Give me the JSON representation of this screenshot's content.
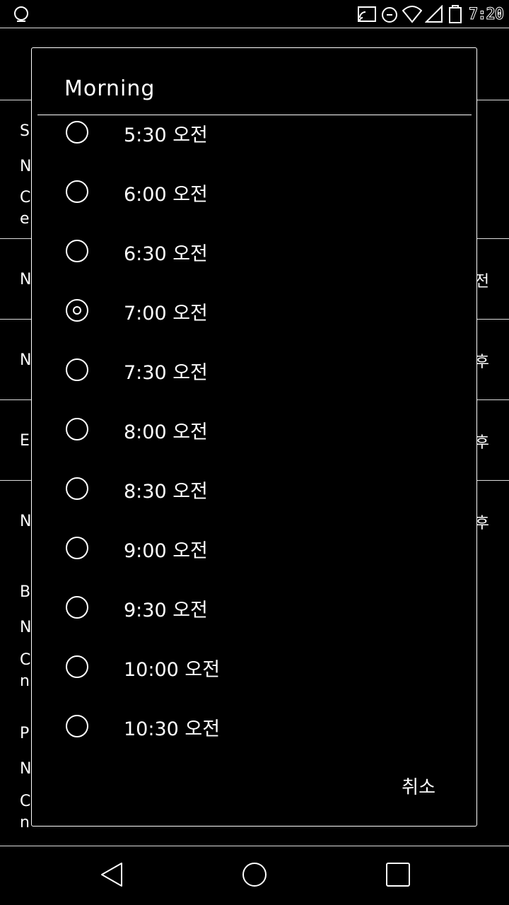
{
  "status_bar": {
    "clock": "7:20",
    "icons": [
      "notification-icon",
      "cast-icon",
      "alarm-icon",
      "wifi-icon",
      "signal-icon",
      "battery-icon"
    ]
  },
  "background": {
    "rows": [
      {
        "letters": [
          "S",
          "N",
          "C",
          "e"
        ]
      },
      {
        "letters": [
          "N"
        ],
        "right": "전"
      },
      {
        "letters": [
          "N"
        ],
        "right": "후"
      },
      {
        "letters": [
          "E"
        ],
        "right": "후"
      },
      {
        "letters": [
          "N"
        ],
        "right": "후"
      },
      {
        "letters": [
          "B",
          "N",
          "C",
          "n"
        ]
      },
      {
        "letters": [
          "P",
          "N",
          "C",
          "n"
        ]
      }
    ]
  },
  "dialog": {
    "title": "Morning",
    "options": [
      {
        "label": "5:30 오전",
        "selected": false
      },
      {
        "label": "6:00 오전",
        "selected": false
      },
      {
        "label": "6:30 오전",
        "selected": false
      },
      {
        "label": "7:00 오전",
        "selected": true
      },
      {
        "label": "7:30 오전",
        "selected": false
      },
      {
        "label": "8:00 오전",
        "selected": false
      },
      {
        "label": "8:30 오전",
        "selected": false
      },
      {
        "label": "9:00 오전",
        "selected": false
      },
      {
        "label": "9:30 오전",
        "selected": false
      },
      {
        "label": "10:00 오전",
        "selected": false
      },
      {
        "label": "10:30 오전",
        "selected": false
      }
    ],
    "cancel_label": "취소"
  },
  "nav_bar": {
    "buttons": [
      "back-icon",
      "home-icon",
      "recents-icon"
    ]
  }
}
